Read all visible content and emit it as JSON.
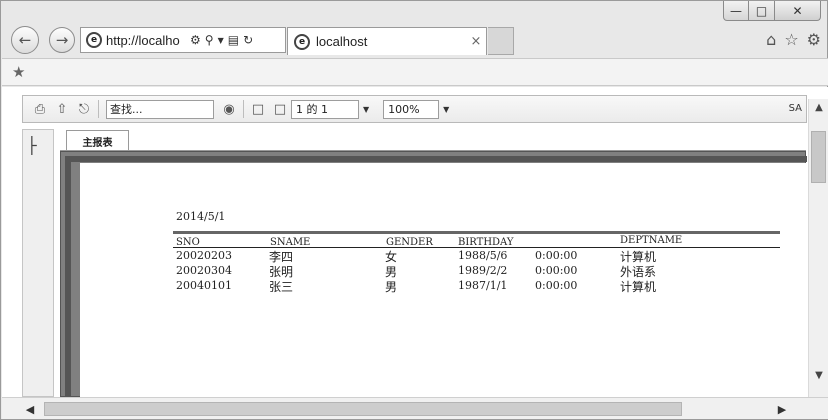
{
  "browser": {
    "address": {
      "url": "http://localho",
      "search_icon": "search-icon",
      "dropdown_icon": "chevron-down-icon",
      "compat_icon": "compatibility-icon",
      "refresh_icon": "refresh-icon"
    },
    "tab": {
      "title": "localhost",
      "close": "×"
    },
    "toolbar_icons": [
      "home-icon",
      "star-icon",
      "gear-icon"
    ]
  },
  "report_toolbar": {
    "find_placeholder": "查找...",
    "page_value": "1 的 1",
    "zoom_value": "100%",
    "trailing_text": "SA"
  },
  "report": {
    "tab_label": "主报表",
    "date": "2014/5/1",
    "columns": [
      "SNO",
      "SNAME",
      "GENDER",
      "BIRTHDAY",
      "DEPTNAME"
    ],
    "rows": [
      {
        "sno": "20020203",
        "sname": "李四",
        "gender": "女",
        "birthday_date": "1988/5/6",
        "birthday_time": "0:00:00",
        "deptname": "计算机"
      },
      {
        "sno": "20020304",
        "sname": "张明",
        "gender": "男",
        "birthday_date": "1989/2/2",
        "birthday_time": "0:00:00",
        "deptname": "外语系"
      },
      {
        "sno": "20040101",
        "sname": "张三",
        "gender": "男",
        "birthday_date": "1987/1/1",
        "birthday_time": "0:00:00",
        "deptname": "计算机"
      }
    ]
  }
}
